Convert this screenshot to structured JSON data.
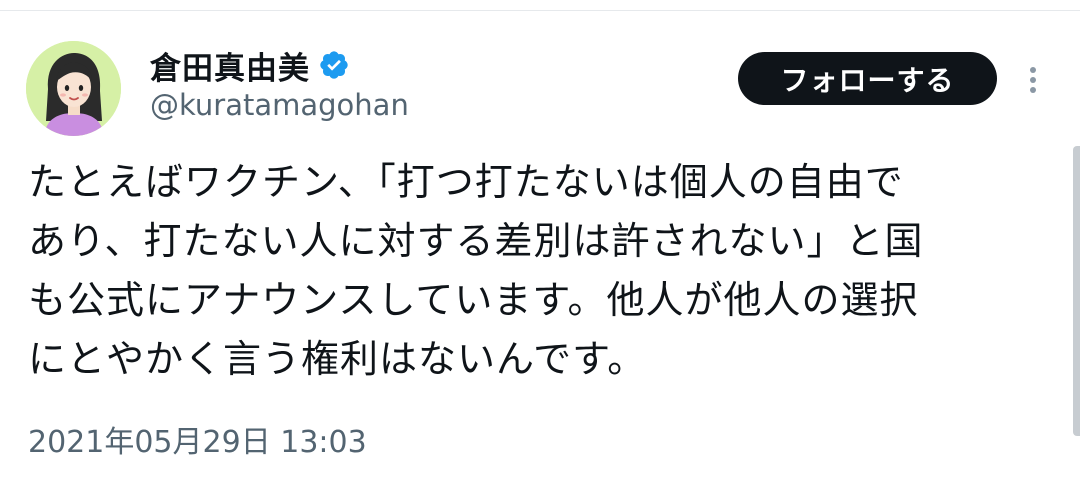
{
  "tweet": {
    "author": {
      "display_name": "倉田真由美",
      "handle": "@kuratamagohan",
      "verified": true,
      "verified_icon": "verified-badge-icon"
    },
    "follow_label": "フォローする",
    "more_icon": "more-options-icon",
    "body_lines": [
      "たとえばワクチン、「打つ打たないは個人の自由で",
      "あり、打たない人に対する差別は許されない」と国",
      "も公式にアナウンスしています。他人が他人の選択",
      "にとやかく言う権利はないんです。"
    ],
    "timestamp": "2021年05月29日 13:03"
  },
  "colors": {
    "text_primary": "#0f1419",
    "text_secondary": "#536471",
    "verified_blue": "#1d9bf0",
    "follow_button_bg": "#0f1419",
    "avatar_bg": "#d6f0a6"
  }
}
